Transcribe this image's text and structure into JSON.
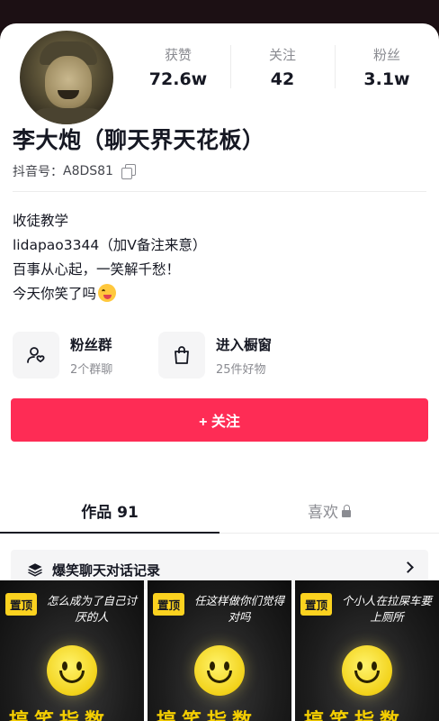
{
  "profile": {
    "avatar_icon": "avatar-photo",
    "name": "李大炮（聊天界天花板）",
    "douyin_id_label": "抖音号：",
    "douyin_id": "A8DS81"
  },
  "stats": [
    {
      "label": "获赞",
      "value": "72.6w"
    },
    {
      "label": "关注",
      "value": "42"
    },
    {
      "label": "粉丝",
      "value": "3.1w"
    }
  ],
  "bio": [
    "收徒教学",
    "lidapao3344（加Ⅴ备注来意）",
    "百事从心起，一笑解千愁！",
    "今天你笑了吗"
  ],
  "shortcuts": [
    {
      "title": "粉丝群",
      "subtitle": "2个群聊",
      "icon": "fan-group-icon"
    },
    {
      "title": "进入橱窗",
      "subtitle": "25件好物",
      "icon": "shopping-bag-icon"
    }
  ],
  "follow_button": "+ 关注",
  "tabs": [
    {
      "label": "作品 91",
      "active": true
    },
    {
      "label": "喜欢",
      "active": false,
      "locked": true
    }
  ],
  "collection": {
    "title": "爆笑聊天对话记录",
    "icon": "layers-icon"
  },
  "videos": [
    {
      "pin": "置顶",
      "caption": "怎么成为了自己讨厌的人",
      "bottom": "搞笑指数"
    },
    {
      "pin": "置顶",
      "caption": "任这样做你们觉得对吗",
      "bottom": "搞笑指数"
    },
    {
      "pin": "置顶",
      "caption": "个小人在拉屎车要上厕所",
      "bottom": "搞笑指数"
    }
  ],
  "colors": {
    "accent": "#fe2c55",
    "pin": "#fbd21f"
  }
}
